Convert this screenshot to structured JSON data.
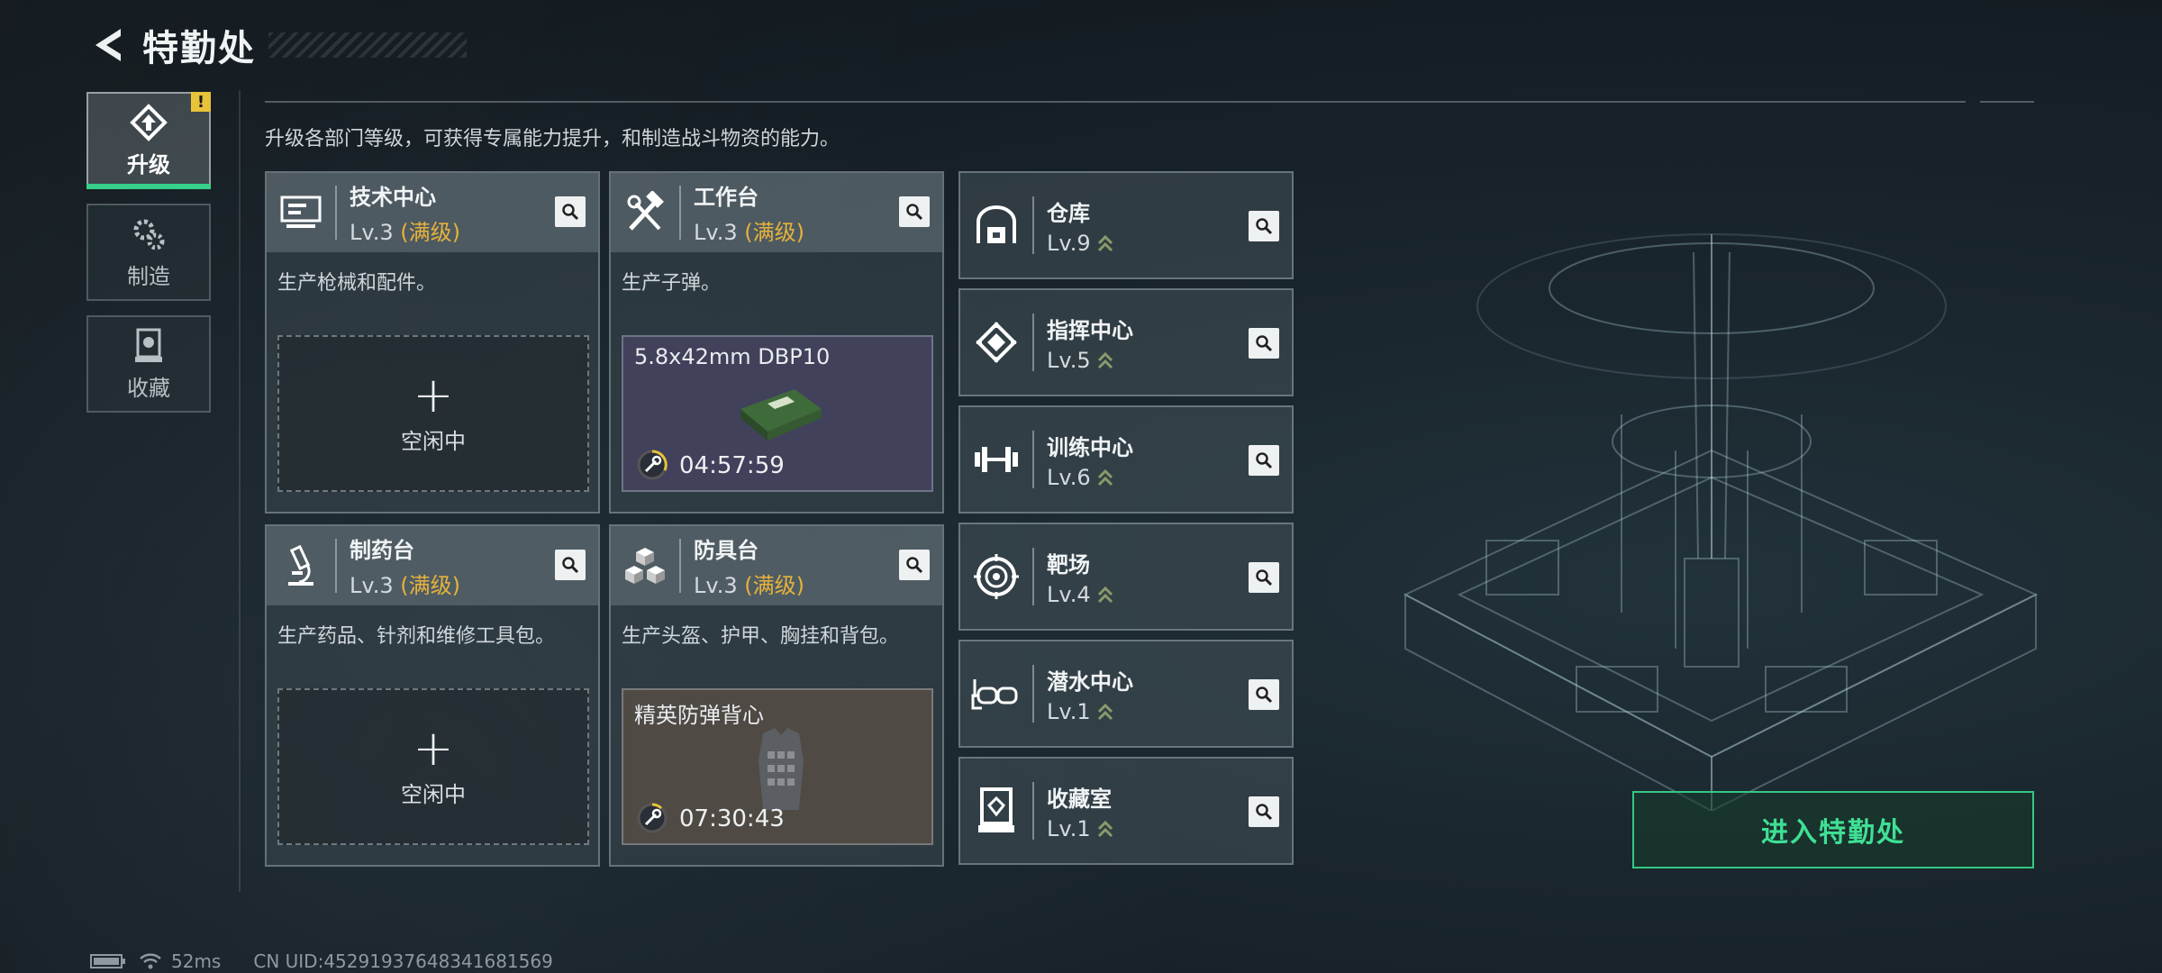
{
  "header": {
    "title": "特勤处"
  },
  "nav": {
    "items": [
      {
        "label": "升级",
        "icon": "upgrade-icon",
        "badge": "!"
      },
      {
        "label": "制造",
        "icon": "gears-icon"
      },
      {
        "label": "收藏",
        "icon": "collection-icon"
      }
    ]
  },
  "subtitle": "升级各部门等级，可获得专属能力提升，和制造战斗物资的能力。",
  "cards": [
    {
      "name": "技术中心",
      "level": "Lv.3",
      "max": "(满级)",
      "desc": "生产枪械和配件。",
      "slot": {
        "state": "idle",
        "label": "空闲中"
      }
    },
    {
      "name": "工作台",
      "level": "Lv.3",
      "max": "(满级)",
      "desc": "生产子弹。",
      "slot": {
        "state": "crafting",
        "item": "5.8x42mm DBP10",
        "timer": "04:57:59"
      }
    },
    {
      "name": "制药台",
      "level": "Lv.3",
      "max": "(满级)",
      "desc": "生产药品、针剂和维修工具包。",
      "slot": {
        "state": "idle",
        "label": "空闲中"
      }
    },
    {
      "name": "防具台",
      "level": "Lv.3",
      "max": "(满级)",
      "desc": "生产头盔、护甲、胸挂和背包。",
      "slot": {
        "state": "crafting",
        "item": "精英防弹背心",
        "timer": "07:30:43"
      }
    }
  ],
  "facilities": [
    {
      "name": "仓库",
      "level": "Lv.9",
      "icon": "warehouse-icon"
    },
    {
      "name": "指挥中心",
      "level": "Lv.5",
      "icon": "command-center-icon"
    },
    {
      "name": "训练中心",
      "level": "Lv.6",
      "icon": "dumbbell-icon"
    },
    {
      "name": "靶场",
      "level": "Lv.4",
      "icon": "target-icon"
    },
    {
      "name": "潜水中心",
      "level": "Lv.1",
      "icon": "diving-mask-icon"
    },
    {
      "name": "收藏室",
      "level": "Lv.1",
      "icon": "display-case-icon"
    }
  ],
  "enter_button": "进入特勤处",
  "status": {
    "ping": "52ms",
    "uid": "CN UID:452919376483416815​69"
  },
  "colors": {
    "accent_green": "#35d08a",
    "max_level": "#e6b23c",
    "badge": "#e8c33a"
  }
}
